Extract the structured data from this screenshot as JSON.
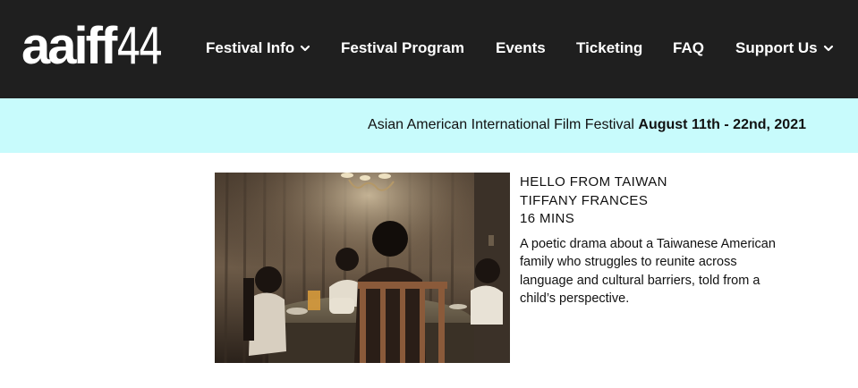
{
  "header": {
    "logo": {
      "word": "aaiff",
      "number": "44"
    },
    "nav": [
      {
        "label": "Festival Info",
        "icon": "chevron-down-icon"
      },
      {
        "label": "Festival Program"
      },
      {
        "label": "Events"
      },
      {
        "label": "Ticketing"
      },
      {
        "label": "FAQ"
      },
      {
        "label": "Support Us",
        "icon": "chevron-down-icon"
      }
    ]
  },
  "banner": {
    "text": "Asian American International Film Festival",
    "dates": "August 11th - 22nd, 2021",
    "background_color": "#c8fbfc"
  },
  "film": {
    "title": "HELLO FROM TAIWAN",
    "director": "TIFFANY FRANCES",
    "runtime": "16 MINS",
    "description": "A poetic drama about a Taiwanese American family who struggles to reunite across language and cultural barriers, told from a child’s perspective."
  },
  "colors": {
    "header_background": "#1f1f1f",
    "header_text": "#ffffff",
    "body_text": "#111111"
  }
}
